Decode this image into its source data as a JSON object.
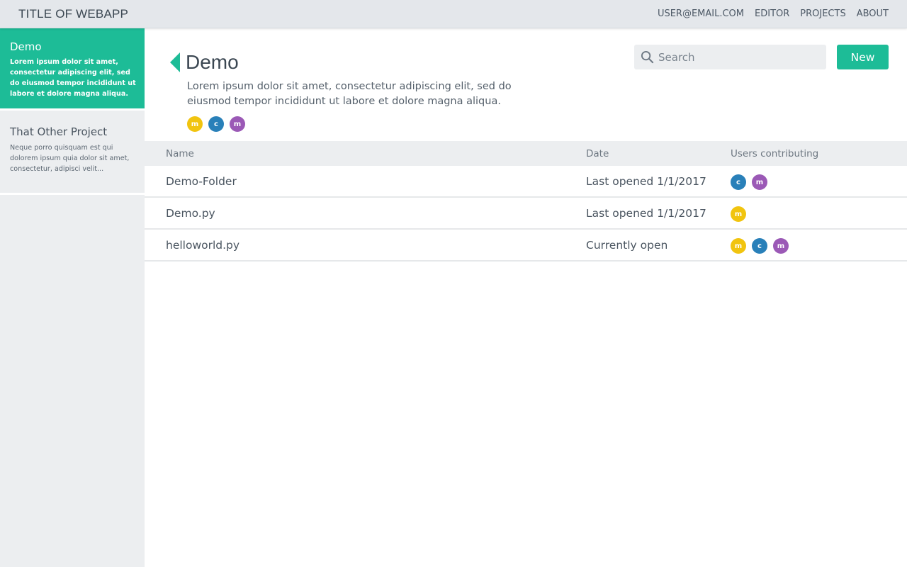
{
  "app": {
    "title": "TITLE OF WEBAPP",
    "nav": [
      "USER@EMAIL.COM",
      "EDITOR",
      "PROJECTS",
      "ABOUT"
    ]
  },
  "colors": {
    "accent": "#1dbc97",
    "avatar_m": "#f1c40f",
    "avatar_c": "#2980b9",
    "avatar_m2": "#9b59b6"
  },
  "sidebar": {
    "projects": [
      {
        "title": "Demo",
        "description": "Lorem ipsum dolor sit amet, consectetur adipiscing elit, sed do eiusmod tempor incididunt ut labore et dolore magna aliqua."
      },
      {
        "title": "That Other Project",
        "description": "Neque porro quisquam est qui dolorem ipsum quia dolor sit amet, consectetur, adipisci velit..."
      }
    ]
  },
  "main": {
    "title": "Demo",
    "description": "Lorem ipsum dolor sit amet, consectetur adipiscing elit, sed do eiusmod tempor incididunt ut labore et dolore magna aliqua.",
    "avatars": [
      "m",
      "c",
      "m"
    ],
    "search": {
      "placeholder": "Search",
      "value": "",
      "icon": "search-icon"
    },
    "new_button": "New"
  },
  "table": {
    "headers": [
      "Name",
      "Date",
      "Users contributing"
    ],
    "rows": [
      {
        "name": "Demo-Folder",
        "date": "Last opened 1/1/2017",
        "users": [
          "c",
          "m"
        ]
      },
      {
        "name": "Demo.py",
        "date": "Last opened 1/1/2017",
        "users": [
          "m"
        ]
      },
      {
        "name": "helloworld.py",
        "date": "Currently open",
        "users": [
          "m",
          "c",
          "m"
        ]
      }
    ]
  }
}
